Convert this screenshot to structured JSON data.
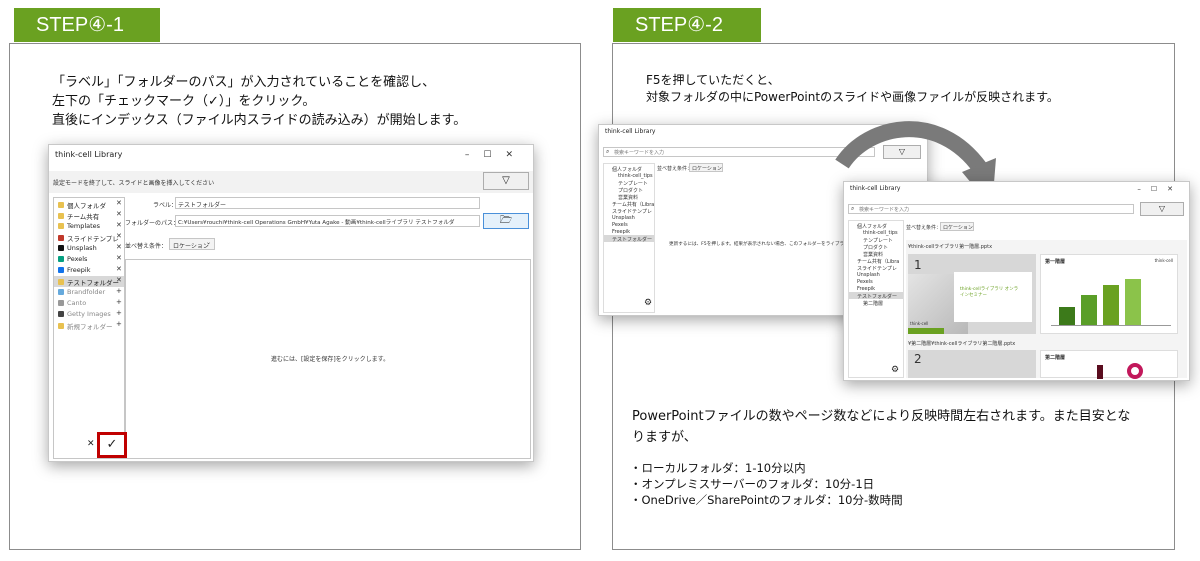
{
  "left": {
    "tab": "STEP④-1",
    "desc_lines": [
      "「ラベル」「フォルダーのパス」が入力されていることを確認し、",
      "左下の「チェックマーク（✓）」をクリック。",
      "直後にインデックス（ファイル内スライドの読み込み）が開始します。"
    ],
    "window": {
      "title": "think-cell Library",
      "controls": "–☐✕",
      "banner": "設定モードを終了して、スライドと画像を挿入してください",
      "filter_icon": "▽",
      "sidebar": [
        {
          "label": "個人フォルダ",
          "mark": "✕",
          "color": "#e8c150"
        },
        {
          "label": "チーム共有",
          "mark": "✕",
          "color": "#e8c150"
        },
        {
          "label": "Templates",
          "mark": "✕",
          "color": "#e8c150"
        },
        {
          "label": "スライドテンプレ",
          "mark": "✕",
          "color": "#c0392b"
        },
        {
          "label": "Unsplash",
          "mark": "✕",
          "color": "#111111"
        },
        {
          "label": "Pexels",
          "mark": "✕",
          "color": "#05a081"
        },
        {
          "label": "Freepik",
          "mark": "✕",
          "color": "#1273eb"
        },
        {
          "label": "テストフォルダー",
          "mark": "✕",
          "color": "#e8c150"
        },
        {
          "label": "Brandfolder",
          "mark": "+",
          "color": "#66aadd"
        },
        {
          "label": "Canto",
          "mark": "+",
          "color": "#999999"
        },
        {
          "label": "Getty Images",
          "mark": "+",
          "color": "#444444"
        },
        {
          "label": "新規フォルダー",
          "mark": "+",
          "color": "#e8c150"
        }
      ],
      "label_caption": "ラベル：",
      "label_value": "テストフォルダー",
      "path_caption": "フォルダーのパス：",
      "path_value": "C:¥Users¥rouchi¥think-cell Operations GmbH¥Yuta Agake - 動画¥think-cellライブラリ テストフォルダ",
      "folder_icon": "🗁",
      "sort_caption": "並べ替え条件：",
      "sort_value": "ロケーション",
      "sort_chevron": "⌄",
      "main_message": "進むには、[設定を保存]をクリックします。",
      "cancel_mark": "✕",
      "check_mark": "✓"
    }
  },
  "right": {
    "tab": "STEP④-2",
    "desc_lines": [
      "F5を押していただくと、",
      "対象フォルダの中にPowerPointのスライドや画像ファイルが反映されます。"
    ],
    "back_window": {
      "title": "think-cell Library",
      "controls": "–☐✕",
      "search_placeholder": "検索キーワードを入力",
      "search_icon": "⌕",
      "filter_icon": "▽",
      "sort_text": "並べ替え条件：",
      "sort_value": "ロケーション",
      "message": "更新するには、F5を押します。結果が表示されない場合、このフォルダーをライブラリに追加",
      "tree": [
        "個人フォルダ",
        "think-cell_tips",
        "テンプレート",
        "プロダクト",
        "営業資料",
        "チーム共有（Libra",
        "スライドテンプレ",
        "Unsplash",
        "Pexels",
        "Freepik",
        "テストフォルダー"
      ],
      "gear_icon": "⚙"
    },
    "front_window": {
      "title": "think-cell Library",
      "controls": "–☐✕",
      "search_placeholder": "検索キーワードを入力",
      "search_icon": "⌕",
      "filter_icon": "▽",
      "sort_text": "並べ替え条件：",
      "sort_value": "ロケーション",
      "tree": [
        "個人フォルダ",
        "think-cell_tips",
        "テンプレート",
        "プロダクト",
        "営業資料",
        "チーム共有（Libra",
        "スライドテンプレ",
        "Unsplash",
        "Pexels",
        "Freepik",
        "テストフォルダー",
        "第二階層"
      ],
      "file1": "¥think-cellライブラリ第一階層.pptx",
      "slide1_num": "1",
      "slide1_title": "think-cellライブラリ オンラインセミナー",
      "slide1_logo": "think-cell",
      "slide2_title": "第一階層",
      "slide2_badge": "think-cell",
      "file2": "¥第二階層¥think-cellライブラリ第二階層.pptx",
      "slide3_num": "2",
      "slide4_title": "第二階層",
      "gear_icon": "⚙"
    },
    "body_lines": [
      "PowerPointファイルの数やページ数などにより反映時間左右されます。また目安とな",
      "りますが、"
    ],
    "bullets": [
      "・ローカルフォルダ：1-10分以内",
      "・オンプレミスサーバーのフォルダ：10分-1日",
      "・OneDrive／SharePointのフォルダ：10分-数時間"
    ]
  }
}
